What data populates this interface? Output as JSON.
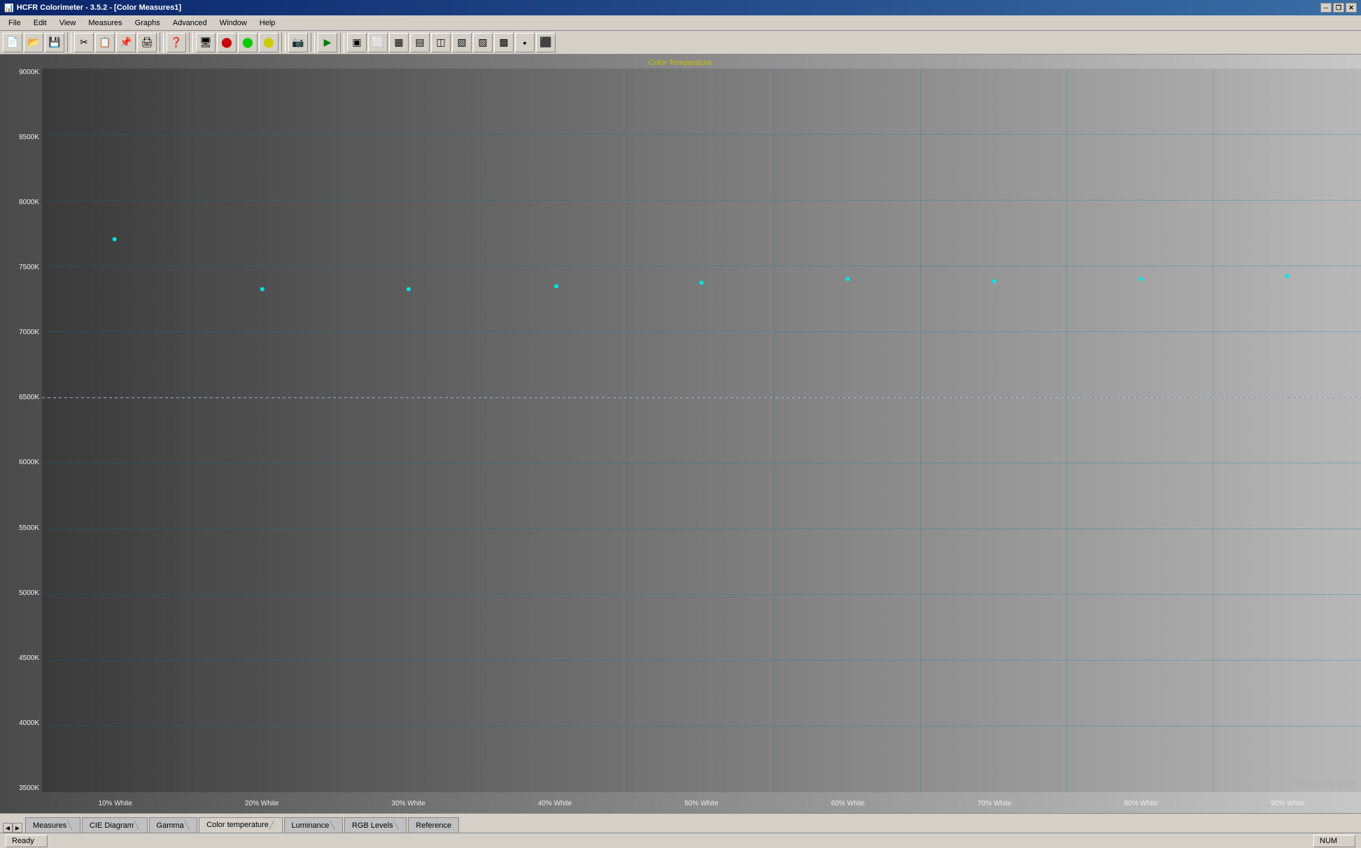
{
  "window": {
    "title": "HCFR Colorimeter - 3.5.2 - [Color Measures1]",
    "icon": "📊"
  },
  "title_bar": {
    "title": "HCFR Colorimeter - 3.5.2 - [Color Measures1]",
    "minimize": "─",
    "maximize": "□",
    "close": "✕",
    "restore": "❐"
  },
  "menu": {
    "items": [
      "File",
      "Edit",
      "View",
      "Measures",
      "Graphs",
      "Advanced",
      "Window",
      "Help"
    ]
  },
  "chart": {
    "title": "Color Temperature",
    "y_labels": [
      "9000K",
      "8500K",
      "8000K",
      "7500K",
      "7000K",
      "6500K",
      "6000K",
      "5500K",
      "5000K",
      "4500K",
      "4000K",
      "3500K"
    ],
    "x_labels": [
      "10% White",
      "20% White",
      "30% White",
      "40% White",
      "50% White",
      "60% White",
      "70% White",
      "80% White",
      "90% White"
    ],
    "watermark": "hcfr.sourceforge.net",
    "ref_label": "6500K"
  },
  "tabs": {
    "items": [
      "Measures",
      "CIE Diagram",
      "Gamma",
      "Color temperature",
      "Luminance",
      "RGB Levels",
      "Reference"
    ],
    "active": "Color temperature"
  },
  "status": {
    "ready": "Ready",
    "num": "NUM"
  }
}
